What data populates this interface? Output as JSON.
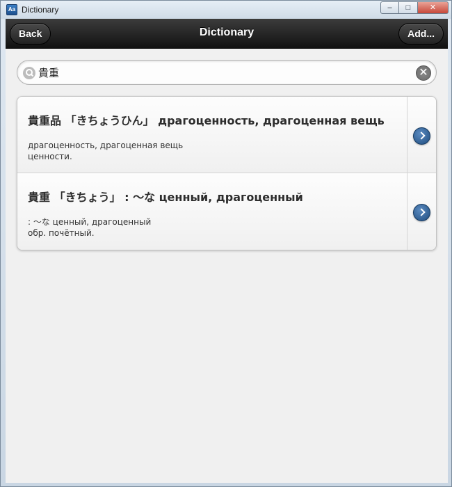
{
  "window": {
    "title": "Dictionary",
    "app_icon_text": "Aa",
    "controls": {
      "minimize": "–",
      "maximize": "□",
      "close": "✕"
    }
  },
  "header": {
    "back_label": "Back",
    "title": "Dictionary",
    "add_label": "Add..."
  },
  "search": {
    "value": "貴重",
    "clear_symbol": "✕"
  },
  "results": [
    {
      "title": "貴重品 「きちょうひん」 драгоценность, драгоценная вещь",
      "lines": [
        "драгоценность, драгоценная вещь",
        "ценности."
      ]
    },
    {
      "title": "貴重 「きちょう」 : ～な ценный, драгоценный",
      "lines": [
        ": ～な ценный, драгоценный",
        "обр. почётный."
      ]
    }
  ]
}
